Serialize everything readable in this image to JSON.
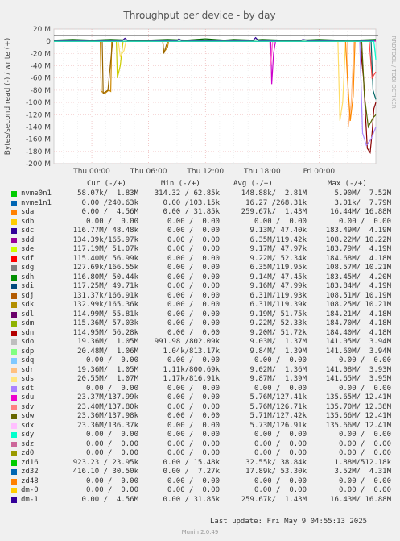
{
  "chart_data": {
    "type": "line",
    "title": "Throughput per device - by day",
    "ylabel": "Bytes/second read (-) / write (+)",
    "side_label": "RRDTOOL / TOBI OETIKER",
    "ylim": [
      -200,
      20
    ],
    "y_ticks": [
      20,
      0,
      -20,
      -40,
      -60,
      -80,
      -100,
      -120,
      -140,
      -160,
      -180,
      -200
    ],
    "y_tick_labels": [
      "20 M",
      "0",
      "-20 M",
      "-40 M",
      "-60 M",
      "-80 M",
      "-100 M",
      "-120 M",
      "-140 M",
      "-160 M",
      "-180 M",
      "-200 M"
    ],
    "y_unit": "M",
    "x_range_hours": [
      -4,
      30
    ],
    "x_ticks": [
      0,
      6,
      12,
      18,
      24
    ],
    "x_tick_labels": [
      "Thu 00:00",
      "Thu 06:00",
      "Thu 12:00",
      "Thu 18:00",
      "Fri 00:00"
    ],
    "grid": true,
    "series": [
      {
        "name": "sdc",
        "color": "#330099",
        "write": [
          [
            -4,
            1
          ],
          [
            3.2,
            1
          ],
          [
            3.5,
            5
          ],
          [
            3.8,
            1
          ],
          [
            9,
            1
          ],
          [
            9.2,
            4
          ],
          [
            9.5,
            1
          ],
          [
            17,
            1
          ],
          [
            17.3,
            6
          ],
          [
            17.6,
            1
          ],
          [
            22,
            1
          ],
          [
            22.3,
            3
          ],
          [
            23,
            1
          ],
          [
            26,
            1
          ],
          [
            27,
            2
          ],
          [
            30,
            1
          ]
        ]
      },
      {
        "name": "sdg",
        "color": "#006600",
        "write": [
          [
            -4,
            2
          ],
          [
            -2,
            3
          ],
          [
            0,
            2
          ],
          [
            2,
            3
          ],
          [
            4,
            2
          ],
          [
            6,
            2
          ],
          [
            8,
            3
          ],
          [
            10,
            2
          ],
          [
            12,
            4
          ],
          [
            14,
            2
          ],
          [
            15,
            3
          ],
          [
            17,
            2
          ],
          [
            18,
            3
          ],
          [
            20,
            2
          ],
          [
            22,
            2
          ],
          [
            24,
            3
          ],
          [
            26,
            2
          ],
          [
            28,
            2
          ],
          [
            30,
            3
          ]
        ]
      },
      {
        "name": "sdk",
        "color": "#cc8800",
        "read": [
          [
            -4,
            0
          ],
          [
            0.9,
            0
          ],
          [
            1,
            -82
          ],
          [
            1.4,
            -85
          ],
          [
            1.8,
            -80
          ],
          [
            2,
            -82
          ],
          [
            2.1,
            0
          ],
          [
            7.5,
            0
          ],
          [
            7.6,
            -18
          ],
          [
            8,
            -10
          ],
          [
            8.1,
            0
          ],
          [
            30,
            0
          ]
        ]
      },
      {
        "name": "sdj",
        "color": "#996600",
        "read": [
          [
            -4,
            0
          ],
          [
            1.1,
            0
          ],
          [
            1.2,
            -85
          ],
          [
            1.7,
            -80
          ],
          [
            2.2,
            0
          ],
          [
            7.5,
            0
          ],
          [
            7.6,
            -20
          ],
          [
            8,
            0
          ],
          [
            30,
            0
          ]
        ]
      },
      {
        "name": "sdl",
        "color": "#cccc00",
        "read": [
          [
            -4,
            0
          ],
          [
            2.6,
            0
          ],
          [
            2.7,
            -60
          ],
          [
            3,
            -40
          ],
          [
            3.3,
            0
          ],
          [
            30,
            0
          ]
        ]
      },
      {
        "name": "sds",
        "color": "#ffdd66",
        "read": [
          [
            -4,
            0
          ],
          [
            2.8,
            0
          ],
          [
            3,
            -25
          ],
          [
            3.4,
            -15
          ],
          [
            3.6,
            0
          ],
          [
            26,
            0
          ],
          [
            26.2,
            -130
          ],
          [
            26.5,
            -100
          ],
          [
            26.8,
            0
          ],
          [
            30,
            0
          ]
        ]
      },
      {
        "name": "sdr",
        "color": "#ffbb88",
        "read": [
          [
            -4,
            0
          ],
          [
            27,
            0
          ],
          [
            27.1,
            -140
          ],
          [
            27.4,
            -100
          ],
          [
            27.7,
            0
          ],
          [
            30,
            0
          ]
        ]
      },
      {
        "name": "sdq",
        "color": "#ff8800",
        "read": [
          [
            -4,
            0
          ],
          [
            26.8,
            0
          ],
          [
            27,
            -60
          ],
          [
            27.3,
            -130
          ],
          [
            27.6,
            -90
          ],
          [
            27.8,
            0
          ],
          [
            30,
            0
          ]
        ]
      },
      {
        "name": "sdo",
        "color": "#cc00cc",
        "read": [
          [
            -4,
            0
          ],
          [
            18.9,
            0
          ],
          [
            19,
            -70
          ],
          [
            19.2,
            -20
          ],
          [
            19.4,
            0
          ],
          [
            30,
            0
          ]
        ]
      },
      {
        "name": "sdp",
        "color": "#ff66cc",
        "read": [
          [
            -4,
            0
          ],
          [
            18.8,
            0
          ],
          [
            18.9,
            -40
          ],
          [
            19.1,
            0
          ],
          [
            30,
            0
          ]
        ]
      },
      {
        "name": "sdn",
        "color": "#880000",
        "read": [
          [
            -4,
            0
          ],
          [
            28.4,
            0
          ],
          [
            28.5,
            -30
          ],
          [
            28.7,
            -60
          ],
          [
            28.9,
            -120
          ],
          [
            29.1,
            -175
          ],
          [
            29.4,
            -182
          ],
          [
            29.6,
            -150
          ],
          [
            29.8,
            -110
          ],
          [
            30,
            -100
          ]
        ]
      },
      {
        "name": "sdt",
        "color": "#aa88ff",
        "read": [
          [
            -4,
            0
          ],
          [
            28.3,
            0
          ],
          [
            28.6,
            -150
          ],
          [
            29,
            -170
          ],
          [
            29.5,
            -160
          ],
          [
            30,
            -140
          ]
        ]
      },
      {
        "name": "sdw",
        "color": "#556600",
        "read": [
          [
            -4,
            0
          ],
          [
            28.5,
            0
          ],
          [
            28.8,
            -90
          ],
          [
            29.2,
            -140
          ],
          [
            29.7,
            -125
          ],
          [
            30,
            -120
          ]
        ]
      },
      {
        "name": "sdx",
        "color": "#006666",
        "read": [
          [
            -4,
            0
          ],
          [
            29.5,
            0
          ],
          [
            29.7,
            -80
          ],
          [
            30,
            -95
          ]
        ]
      },
      {
        "name": "sdv",
        "color": "#ff4444",
        "read": [
          [
            -4,
            0
          ],
          [
            29.3,
            0
          ],
          [
            29.6,
            -60
          ],
          [
            30,
            -50
          ]
        ]
      },
      {
        "name": "sdy",
        "color": "#00ffcc",
        "read": [
          [
            -4,
            0
          ],
          [
            29.8,
            0
          ],
          [
            30,
            -30
          ]
        ]
      }
    ]
  },
  "legend": {
    "header": {
      "cur": "Cur (-/+)",
      "min": "Min (-/+)",
      "avg": "Avg (-/+)",
      "max": "Max (-/+)"
    },
    "rows": [
      {
        "name": "nvme0n1",
        "color": "#00cc00",
        "cur": "58.07k/  1.83M",
        "min": "314.32 / 62.85k",
        "avg": "148.88k/  2.81M",
        "max": "5.90M/  7.52M"
      },
      {
        "name": "nvme1n1",
        "color": "#0066b3",
        "cur": "0.00 /240.63k",
        "min": "0.00 /103.15k",
        "avg": "16.27 /268.31k",
        "max": "3.01k/  7.79M"
      },
      {
        "name": "sda",
        "color": "#ff8000",
        "cur": "0.00 /  4.56M",
        "min": "0.00 / 31.85k",
        "avg": "259.67k/  1.43M",
        "max": "16.44M/ 16.88M"
      },
      {
        "name": "sdb",
        "color": "#ffcc00",
        "cur": "0.00 /  0.00",
        "min": "0.00 /  0.00",
        "avg": "0.00 /  0.00",
        "max": "0.00 /  0.00"
      },
      {
        "name": "sdc",
        "color": "#330099",
        "cur": "116.77M/ 48.48k",
        "min": "0.00 /  0.00",
        "avg": "9.13M/ 47.40k",
        "max": "183.49M/  4.19M"
      },
      {
        "name": "sdd",
        "color": "#990099",
        "cur": "134.39k/165.97k",
        "min": "0.00 /  0.00",
        "avg": "6.35M/119.42k",
        "max": "108.22M/ 10.22M"
      },
      {
        "name": "sde",
        "color": "#ccff00",
        "cur": "117.19M/ 51.07k",
        "min": "0.00 /  0.00",
        "avg": "9.17M/ 47.97k",
        "max": "183.79M/  4.19M"
      },
      {
        "name": "sdf",
        "color": "#ff0000",
        "cur": "115.40M/ 56.99k",
        "min": "0.00 /  0.00",
        "avg": "9.22M/ 52.34k",
        "max": "184.68M/  4.18M"
      },
      {
        "name": "sdg",
        "color": "#808080",
        "cur": "127.69k/166.55k",
        "min": "0.00 /  0.00",
        "avg": "6.35M/119.95k",
        "max": "108.57M/ 10.21M"
      },
      {
        "name": "sdh",
        "color": "#008f00",
        "cur": "116.80M/ 50.44k",
        "min": "0.00 /  0.00",
        "avg": "9.14M/ 47.45k",
        "max": "183.45M/  4.20M"
      },
      {
        "name": "sdi",
        "color": "#00487d",
        "cur": "117.25M/ 49.71k",
        "min": "0.00 /  0.00",
        "avg": "9.16M/ 47.99k",
        "max": "183.84M/  4.19M"
      },
      {
        "name": "sdj",
        "color": "#b35a00",
        "cur": "131.37k/166.91k",
        "min": "0.00 /  0.00",
        "avg": "6.31M/119.93k",
        "max": "108.51M/ 10.19M"
      },
      {
        "name": "sdk",
        "color": "#b38f00",
        "cur": "132.99k/165.36k",
        "min": "0.00 /  0.00",
        "avg": "6.31M/119.39k",
        "max": "108.25M/ 10.21M"
      },
      {
        "name": "sdl",
        "color": "#6b006b",
        "cur": "114.99M/ 55.81k",
        "min": "0.00 /  0.00",
        "avg": "9.19M/ 51.75k",
        "max": "184.21M/  4.18M"
      },
      {
        "name": "sdm",
        "color": "#8fb300",
        "cur": "115.36M/ 57.03k",
        "min": "0.00 /  0.00",
        "avg": "9.22M/ 52.33k",
        "max": "184.70M/  4.18M"
      },
      {
        "name": "sdn",
        "color": "#b30000",
        "cur": "114.95M/ 56.28k",
        "min": "0.00 /  0.00",
        "avg": "9.20M/ 51.72k",
        "max": "184.40M/  4.18M"
      },
      {
        "name": "sdo",
        "color": "#bebebe",
        "cur": "19.36M/  1.05M",
        "min": "991.98 /802.09k",
        "avg": "9.03M/  1.37M",
        "max": "141.05M/  3.94M"
      },
      {
        "name": "sdp",
        "color": "#80ff80",
        "cur": "20.48M/  1.06M",
        "min": "1.04k/813.17k",
        "avg": "9.84M/  1.39M",
        "max": "141.60M/  3.94M"
      },
      {
        "name": "sdq",
        "color": "#80c9ff",
        "cur": "0.00 /  0.00",
        "min": "0.00 /  0.00",
        "avg": "0.00 /  0.00",
        "max": "0.00 /  0.00"
      },
      {
        "name": "sdr",
        "color": "#ffc080",
        "cur": "19.36M/  1.05M",
        "min": "1.11k/800.69k",
        "avg": "9.02M/  1.36M",
        "max": "141.08M/  3.93M"
      },
      {
        "name": "sds",
        "color": "#ffe680",
        "cur": "20.55M/  1.07M",
        "min": "1.17k/816.91k",
        "avg": "9.87M/  1.39M",
        "max": "141.65M/  3.95M"
      },
      {
        "name": "sdt",
        "color": "#aa80ff",
        "cur": "0.00 /  0.00",
        "min": "0.00 /  0.00",
        "avg": "0.00 /  0.00",
        "max": "0.00 /  0.00"
      },
      {
        "name": "sdu",
        "color": "#ee00cc",
        "cur": "23.37M/137.99k",
        "min": "0.00 /  0.00",
        "avg": "5.76M/127.41k",
        "max": "135.65M/ 12.41M"
      },
      {
        "name": "sdv",
        "color": "#ff8080",
        "cur": "23.40M/137.80k",
        "min": "0.00 /  0.00",
        "avg": "5.76M/126.71k",
        "max": "135.70M/ 12.38M"
      },
      {
        "name": "sdw",
        "color": "#666600",
        "cur": "23.36M/137.98k",
        "min": "0.00 /  0.00",
        "avg": "5.71M/127.42k",
        "max": "135.66M/ 12.41M"
      },
      {
        "name": "sdx",
        "color": "#ffbfff",
        "cur": "23.36M/136.37k",
        "min": "0.00 /  0.00",
        "avg": "5.73M/126.91k",
        "max": "135.66M/ 12.41M"
      },
      {
        "name": "sdy",
        "color": "#00ffcc",
        "cur": "0.00 /  0.00",
        "min": "0.00 /  0.00",
        "avg": "0.00 /  0.00",
        "max": "0.00 /  0.00"
      },
      {
        "name": "sdz",
        "color": "#cc6699",
        "cur": "0.00 /  0.00",
        "min": "0.00 /  0.00",
        "avg": "0.00 /  0.00",
        "max": "0.00 /  0.00"
      },
      {
        "name": "zd0",
        "color": "#999900",
        "cur": "0.00 /  0.00",
        "min": "0.00 /  0.00",
        "avg": "0.00 /  0.00",
        "max": "0.00 /  0.00"
      },
      {
        "name": "zd16",
        "color": "#00cc00",
        "cur": "923.23 / 23.95k",
        "min": "0.00 / 15.48k",
        "avg": "32.55k/ 38.84k",
        "max": "1.88M/512.18k"
      },
      {
        "name": "zd32",
        "color": "#0066b3",
        "cur": "416.10 / 30.50k",
        "min": "0.00 /  7.27k",
        "avg": "17.89k/ 53.30k",
        "max": "3.52M/  4.31M"
      },
      {
        "name": "zd48",
        "color": "#ff8000",
        "cur": "0.00 /  0.00",
        "min": "0.00 /  0.00",
        "avg": "0.00 /  0.00",
        "max": "0.00 /  0.00"
      },
      {
        "name": "dm-0",
        "color": "#ffcc00",
        "cur": "0.00 /  0.00",
        "min": "0.00 /  0.00",
        "avg": "0.00 /  0.00",
        "max": "0.00 /  0.00"
      },
      {
        "name": "dm-1",
        "color": "#330099",
        "cur": "0.00 /  4.56M",
        "min": "0.00 / 31.85k",
        "avg": "259.67k/  1.43M",
        "max": "16.43M/ 16.88M"
      }
    ]
  },
  "footer": {
    "last_update": "Last update: Fri May  9 04:55:13 2025",
    "generator": "Munin 2.0.49"
  }
}
